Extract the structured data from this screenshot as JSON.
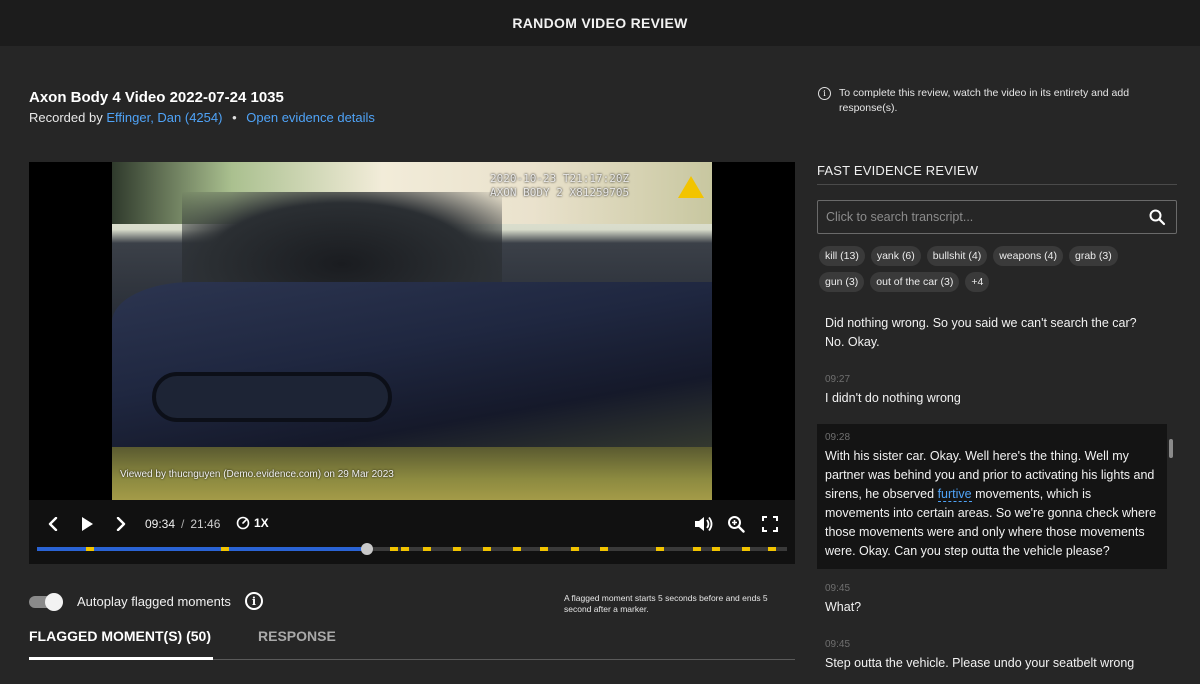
{
  "header": {
    "title": "RANDOM VIDEO REVIEW"
  },
  "evidence": {
    "title": "Axon Body 4 Video 2022-07-24 1035",
    "recorded_prefix": "Recorded by",
    "officer": "Effinger, Dan (4254)",
    "details_link": "Open evidence details"
  },
  "video": {
    "overlay_timestamp": "2020-10-23 T21:17:20Z\nAXON BODY 2 X81259705",
    "watermark": "Viewed by thucnguyen (Demo.evidence.com) on 29 Mar 2023",
    "current_time": "09:34",
    "separator": "/",
    "total_time": "21:46",
    "speed": "1X",
    "progress_fraction": 0.44,
    "flag_markers": [
      0.065,
      0.245,
      0.47,
      0.485,
      0.515,
      0.555,
      0.595,
      0.635,
      0.67,
      0.712,
      0.75,
      0.825,
      0.875,
      0.9,
      0.94,
      0.975
    ]
  },
  "autoplay": {
    "label": "Autoplay flagged moments",
    "enabled": true
  },
  "flag_note": "A flagged moment starts 5 seconds before and ends 5 second after a marker.",
  "tabs": [
    {
      "label": "FLAGGED MOMENT(S) (50)",
      "active": true
    },
    {
      "label": "RESPONSE",
      "active": false
    }
  ],
  "notice": "To complete this review, watch the video in its entirety and add response(s).",
  "fast_review": {
    "title": "FAST EVIDENCE REVIEW",
    "search_placeholder": "Click to search transcript...",
    "chips_row1": [
      "kill (13)",
      "yank (6)",
      "bullshit (4)",
      "weapons (4)",
      "grab (3)"
    ],
    "chips_row2": [
      "gun (3)",
      "out of the car (3)",
      "+4"
    ]
  },
  "transcript": [
    {
      "time": "",
      "text": "Did nothing wrong. So you said we can't search the car? No. Okay."
    },
    {
      "time": "09:27",
      "text": "I didn't do nothing wrong"
    },
    {
      "time": "09:28",
      "text_before": "With his sister car. Okay. Well here's the thing. Well my partner was behind you and prior to activating his lights and sirens, he observed ",
      "highlight": "furtive",
      "text_after": " movements, which is movements into certain areas. So we're gonna check where those movements were and only where those movements were. Okay. Can you step outta the vehicle please?"
    },
    {
      "time": "09:45",
      "text": "What?"
    },
    {
      "time": "09:45",
      "text": "Step outta the vehicle. Please undo your seatbelt wrong"
    }
  ],
  "colors": {
    "accent_link": "#4fa3f7",
    "progress": "#2a63d4",
    "flag_marker": "#f2c400",
    "background": "#262626"
  }
}
